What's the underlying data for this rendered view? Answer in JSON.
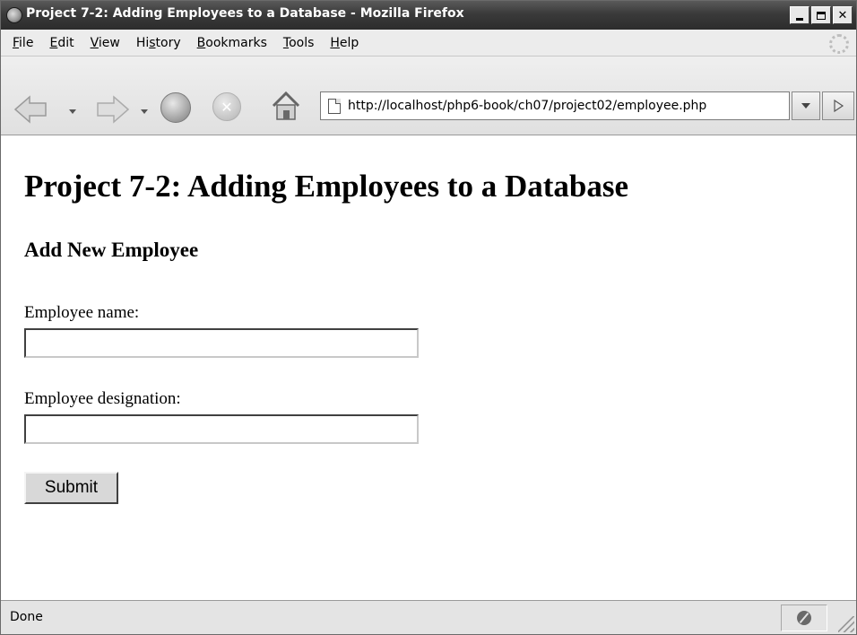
{
  "window": {
    "title": "Project 7-2: Adding Employees to a Database - Mozilla Firefox",
    "controls": [
      "minimize",
      "maximize",
      "close"
    ]
  },
  "menubar": {
    "items": [
      {
        "label": "File",
        "accel": "F"
      },
      {
        "label": "Edit",
        "accel": "E"
      },
      {
        "label": "View",
        "accel": "V"
      },
      {
        "label": "History",
        "accel": "s"
      },
      {
        "label": "Bookmarks",
        "accel": "B"
      },
      {
        "label": "Tools",
        "accel": "T"
      },
      {
        "label": "Help",
        "accel": "H"
      }
    ]
  },
  "toolbar": {
    "icons": [
      "back-icon",
      "forward-icon",
      "reload-icon",
      "stop-icon",
      "home-icon",
      "page-icon",
      "dropdown-icon",
      "go-icon"
    ],
    "url": "http://localhost/php6-book/ch07/project02/employee.php"
  },
  "page": {
    "title": "Project 7-2: Adding Employees to a Database",
    "section_title": "Add New Employee",
    "form": {
      "name_label": "Employee name:",
      "name_value": "",
      "designation_label": "Employee designation:",
      "designation_value": "",
      "submit_label": "Submit"
    }
  },
  "statusbar": {
    "text": "Done"
  },
  "colors": {
    "titlebar": "#3a3a3a",
    "chrome": "#e4e4e4",
    "content_bg": "#ffffff"
  }
}
